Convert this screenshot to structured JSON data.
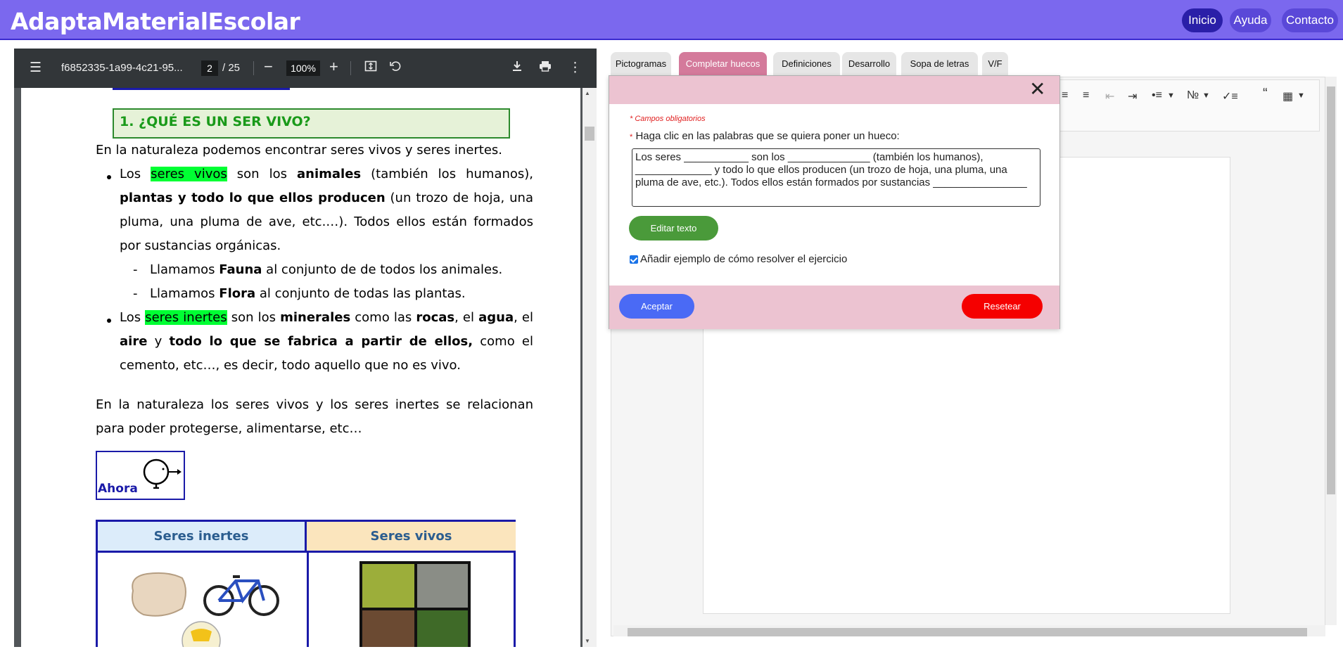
{
  "header": {
    "brand": "AdaptaMaterialEscolar",
    "nav": [
      {
        "label": "Inicio",
        "active": true
      },
      {
        "label": "Ayuda",
        "active": false
      },
      {
        "label": "Contacto",
        "active": false
      }
    ],
    "color": "#7b68ee"
  },
  "pdf_viewer": {
    "filename": "f6852335-1a99-4c21-95...",
    "page_current": "2",
    "page_total": "/ 25",
    "zoom": "100%",
    "icons": [
      "menu-icon",
      "zoom-out-icon",
      "zoom-in-icon",
      "fit-page-icon",
      "rotate-icon",
      "download-icon",
      "print-icon",
      "more-options-icon"
    ]
  },
  "document": {
    "heading": "1. ¿QUÉ ES UN SER VIVO?",
    "intro": "En la naturaleza podemos encontrar seres vivos y seres inertes.",
    "bullet1": {
      "lead": "Los ",
      "hl": "seres vivos",
      "t1": " son los ",
      "b1": "animales",
      "t2": " (también los humanos), ",
      "b2": "plantas y todo lo que ellos producen",
      "t3": " (un trozo de hoja, una pluma, una pluma de ave, etc.…). Todos ellos están formados por sustancias orgánicas."
    },
    "sub1": {
      "pre": "Llamamos ",
      "b": "Fauna",
      "post": " al conjunto de de todos los animales."
    },
    "sub2": {
      "pre": "Llamamos ",
      "b": "Flora",
      "post": " al conjunto de todas las plantas."
    },
    "bullet2": {
      "lead": "Los ",
      "hl": "seres inertes",
      "t1": " son los ",
      "b1": "minerales",
      "t2": " como las ",
      "b2": "rocas",
      "t3": ", el ",
      "b3": "agua",
      "t4": ", el ",
      "b4": "aire",
      "t5": " y ",
      "b5": "todo lo que se fabrica a partir de ellos,",
      "t6": " como el cemento, etc…, es decir, todo aquello que no es vivo."
    },
    "para2": "En la naturaleza los seres vivos y los seres inertes se relacionan para poder protegerse, alimentarse, etc…",
    "ahora": "Ahora",
    "table_headers": [
      "Seres inertes",
      "Seres vivos"
    ]
  },
  "tabs": [
    {
      "label": "Pictogramas",
      "active": false
    },
    {
      "label": "Completar huecos",
      "active": true
    },
    {
      "label": "Definiciones",
      "active": false
    },
    {
      "label": "Desarrollo",
      "active": false
    },
    {
      "label": "Sopa de letras",
      "active": false
    },
    {
      "label": "V/F",
      "active": false
    }
  ],
  "modal": {
    "required_note": "* Campos obligatorios",
    "field_label": "Haga clic en las palabras que se quiera poner un hueco:",
    "field_star": "*",
    "textarea_value": "Los seres ___________ son los ______________ (también los humanos), _____________ y todo lo que ellos producen (un trozo de hoja, una pluma, una pluma de ave, etc.). Todos ellos están formados por sustancias ________________",
    "edit_button": "Editar texto",
    "checkbox_label": "Añadir ejemplo de cómo resolver el ejercicio",
    "checkbox_checked": true,
    "accept_button": "Aceptar",
    "reset_button": "Resetear"
  }
}
